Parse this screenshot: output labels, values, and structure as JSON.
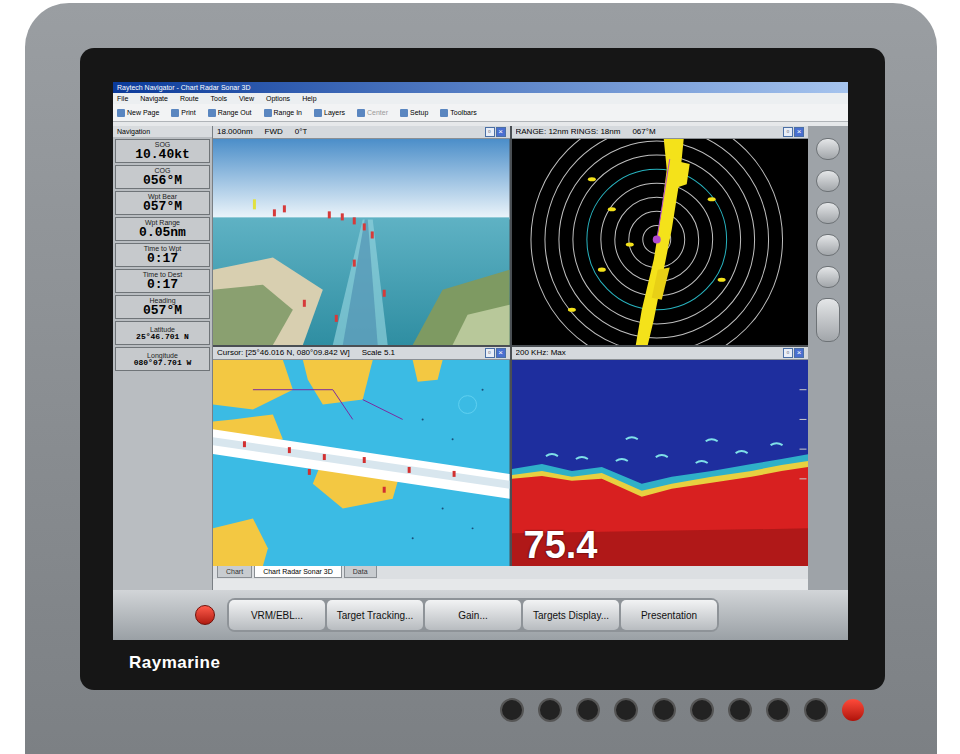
{
  "window": {
    "title": "Raytech Navigator - Chart Radar Sonar 3D",
    "menu": [
      "File",
      "Navigate",
      "Route",
      "Tools",
      "View",
      "Options",
      "Help"
    ],
    "toolbar": [
      {
        "label": "New Page",
        "disabled": false
      },
      {
        "label": "Print",
        "disabled": false
      },
      {
        "label": "Range Out",
        "disabled": false
      },
      {
        "label": "Range In",
        "disabled": false
      },
      {
        "label": "Layers",
        "disabled": false
      },
      {
        "label": "Center",
        "disabled": true
      },
      {
        "label": "Setup",
        "disabled": false
      },
      {
        "label": "Toolbars",
        "disabled": false
      }
    ]
  },
  "sidebar": {
    "title": "Navigation",
    "items": [
      {
        "label": "SOG",
        "value": "10.40kt"
      },
      {
        "label": "COG",
        "value": "056°M"
      },
      {
        "label": "Wpt Bear",
        "value": "057°M"
      },
      {
        "label": "Wpt Range",
        "value": "0.05nm"
      },
      {
        "label": "Time to Wpt",
        "value": "0:17"
      },
      {
        "label": "Time to Dest",
        "value": "0:17"
      },
      {
        "label": "Heading",
        "value": "057°M"
      },
      {
        "label": "Latitude",
        "value": "25°46.701 N"
      },
      {
        "label": "Longitude",
        "value": "080°07.701 W"
      }
    ]
  },
  "window_buttons": [
    "▫",
    "×"
  ],
  "panels": {
    "view3d": {
      "range": "18.000nm",
      "mode": "FWD",
      "bearing": "0°T"
    },
    "radar": {
      "header": "RANGE: 12nm RINGS: 18nm",
      "heading": "067°M"
    },
    "chart": {
      "cursor": "Cursor: [25°46.016 N, 080°09.842 W]",
      "scale": "Scale 5.1"
    },
    "sonar": {
      "header": "200 KHz: Max",
      "depth": "75.4"
    }
  },
  "page_tabs": [
    {
      "label": "Chart",
      "selected": false
    },
    {
      "label": "Chart Radar Sonar 3D",
      "selected": true
    },
    {
      "label": "Data",
      "selected": false
    }
  ],
  "softkeys": [
    "VRM/EBL...",
    "Target Tracking...",
    "Gain...",
    "Targets Display...",
    "Presentation"
  ],
  "brand": "Raymarine"
}
